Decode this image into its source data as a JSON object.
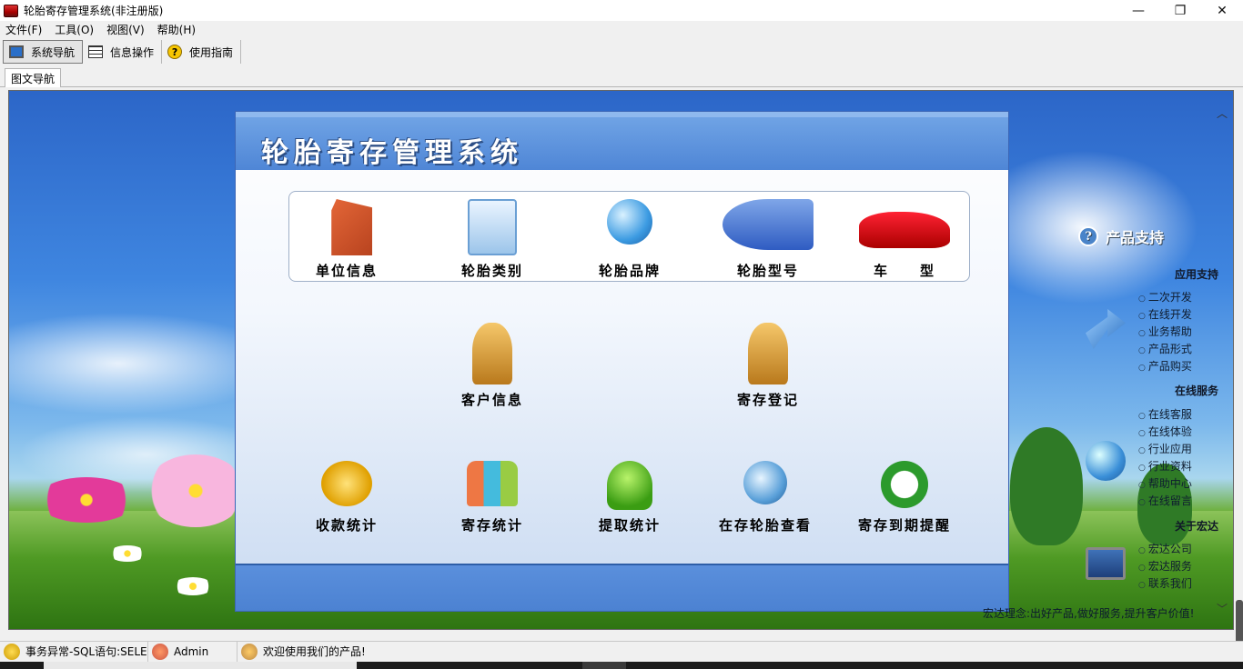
{
  "window": {
    "title": "轮胎寄存管理系统(非注册版)",
    "controls": {
      "minimize": "—",
      "restore": "❐",
      "close": "✕"
    }
  },
  "menu": [
    "文件(F)",
    "工具(O)",
    "视图(V)",
    "帮助(H)"
  ],
  "toolbar": [
    {
      "label": "系统导航",
      "icon": "monitor-icon",
      "active": true
    },
    {
      "label": "信息操作",
      "icon": "grid-icon",
      "active": false
    },
    {
      "label": "使用指南",
      "icon": "help-icon",
      "active": false
    }
  ],
  "tab": "图文导航",
  "panel": {
    "title": "轮胎寄存管理系统",
    "top_row": [
      {
        "label": "单位信息",
        "icon": "building-icon"
      },
      {
        "label": "轮胎类别",
        "icon": "document-icon"
      },
      {
        "label": "轮胎品牌",
        "icon": "globe-car-icon"
      },
      {
        "label": "轮胎型号",
        "icon": "pipe-icon"
      },
      {
        "label": "车　　型",
        "icon": "sports-car-icon"
      }
    ],
    "middle_row": [
      {
        "label": "客户信息",
        "icon": "person-document-icon"
      },
      {
        "label": "寄存登记",
        "icon": "person-pen-icon"
      }
    ],
    "bottom_row": [
      {
        "label": "收款统计",
        "icon": "coins-icon"
      },
      {
        "label": "寄存统计",
        "icon": "people-chart-icon"
      },
      {
        "label": "提取统计",
        "icon": "user-bag-icon"
      },
      {
        "label": "在存轮胎查看",
        "icon": "magnifier-icon"
      },
      {
        "label": "寄存到期提醒",
        "icon": "alarm-clock-icon"
      }
    ]
  },
  "sidebar": {
    "header": "产品支持",
    "sections": [
      {
        "title": "应用支持",
        "links": [
          "二次开发",
          "在线开发",
          "业务帮助",
          "产品形式",
          "产品购买"
        ]
      },
      {
        "title": "在线服务",
        "links": [
          "在线客服",
          "在线体验",
          "行业应用",
          "行业资料",
          "帮助中心",
          "在线留言"
        ]
      },
      {
        "title": "关于宏达",
        "links": [
          "宏达公司",
          "宏达服务",
          "联系我们"
        ]
      }
    ],
    "slogan": "宏达理念:出好产品,做好服务,提升客户价值!"
  },
  "status": {
    "message": "事务异常-SQL语句:SELEC",
    "user": "Admin",
    "welcome": "欢迎使用我们的产品!"
  },
  "colors": {
    "accent": "#4f86d6",
    "panel_border": "#3c66b6"
  }
}
